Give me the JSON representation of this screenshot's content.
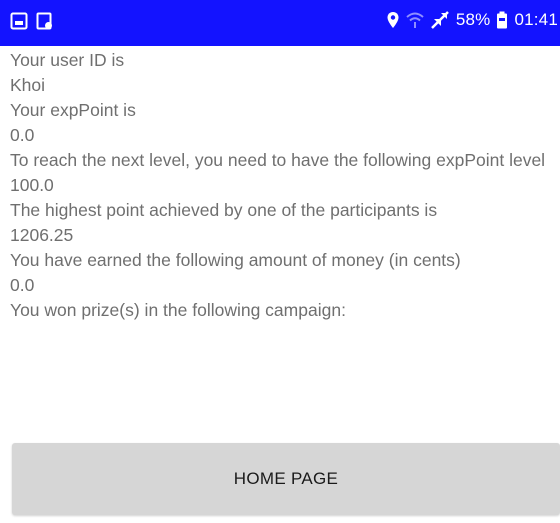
{
  "status_bar": {
    "battery": "58%",
    "time": "01:41",
    "background_color": "#1313ff",
    "icons_left": [
      "image-icon",
      "gallery-icon"
    ],
    "icons_right": [
      "location-icon",
      "wifi-icon",
      "airplane-icon",
      "battery-icon"
    ]
  },
  "content": {
    "user_id_label": "Your user ID is",
    "user_id_value": "Khoi",
    "exp_label": "Your expPoint is",
    "exp_value": "0.0",
    "next_level_label": "To reach the next level, you need to have the following expPoint level",
    "next_level_value": "100.0",
    "highest_label": "The highest point achieved by one of the participants is",
    "highest_value": "1206.25",
    "money_label": "You have earned the following amount of money (in cents)",
    "money_value": "0.0",
    "prize_label": "You won prize(s) in the following campaign:"
  },
  "home_button": {
    "label": "HOME PAGE"
  }
}
